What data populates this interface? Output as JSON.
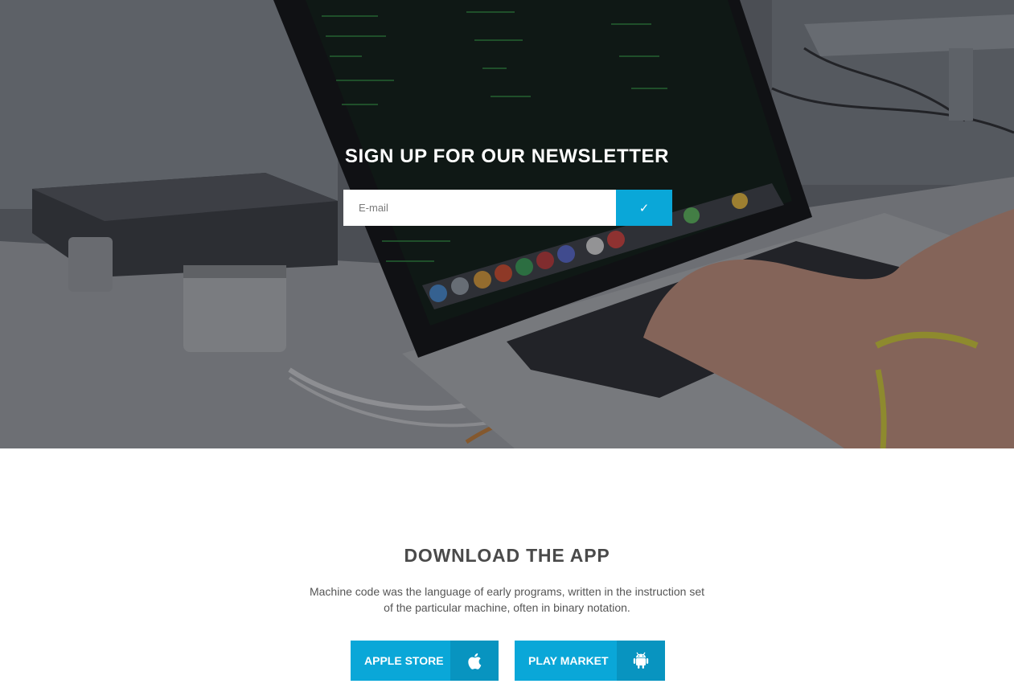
{
  "newsletter": {
    "title": "SIGN UP FOR OUR NEWSLETTER",
    "email_placeholder": "E-mail",
    "submit_icon": "checkmark-icon",
    "submit_glyph": "✓"
  },
  "download": {
    "title": "DOWNLOAD THE APP",
    "description": "Machine code was the language of early programs, written in the instruction set of the particular machine, often in binary notation.",
    "buttons": [
      {
        "label": "APPLE STORE",
        "icon": "apple-icon"
      },
      {
        "label": "PLAY MARKET",
        "icon": "android-icon"
      }
    ]
  },
  "colors": {
    "accent": "#0aa7d8",
    "accent_dark": "#0894c0",
    "heading": "#4a4a4a",
    "body_text": "#555555"
  }
}
